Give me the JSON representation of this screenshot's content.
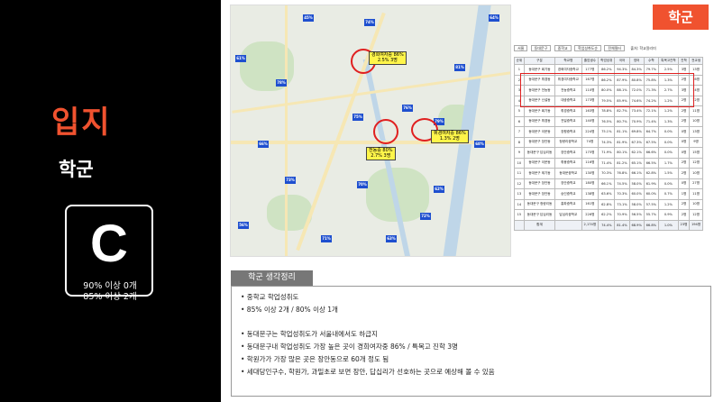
{
  "sidebar": {
    "title": "입지",
    "subtitle": "학군",
    "grade": "C",
    "grade_note_1": "90% 이상 0개",
    "grade_note_2": "85% 이상 2개"
  },
  "tag": "학군",
  "map": {
    "callouts": [
      {
        "l1": "경희여자중 86%",
        "l2": "2.5% 3명"
      },
      {
        "l1": "전농중 80%",
        "l2": "2.7% 3명"
      },
      {
        "l1": "휘경여자중 86%",
        "l2": "1.3% 2명"
      }
    ]
  },
  "filters": {
    "region": "서울",
    "district": "동대문구",
    "level": "중학교",
    "opt1": "학업성취도순",
    "opt2": "전체필터",
    "unit": "출처: 학교알리미"
  },
  "table": {
    "headers": [
      "순위",
      "구분",
      "학교명",
      "졸업생수",
      "학업성취",
      "국어",
      "영어",
      "수학",
      "특목고진학",
      "진학",
      "전교생"
    ],
    "rows": [
      [
        "1",
        "동대문구 회기동",
        "경희여자중학교",
        "177명",
        "86.2%",
        "94.3%",
        "84.3%",
        "79.7%",
        "2.5%",
        "3명",
        "13명"
      ],
      [
        "2",
        "동대문구 휘경동",
        "휘경여자중학교",
        "167명",
        "86.2%",
        "87.9%",
        "80.8%",
        "75.8%",
        "1.3%",
        "2명",
        "16명"
      ],
      [
        "3",
        "동대문구 전농동",
        "전농중학교",
        "110명",
        "80.0%",
        "88.1%",
        "72.0%",
        "71.3%",
        "2.7%",
        "3명",
        "14명"
      ],
      [
        "4",
        "동대문구 신설동",
        "대광중학교",
        "173명",
        "79.5%",
        "85.9%",
        "74.6%",
        "74.2%",
        "1.2%",
        "2명",
        "12명"
      ],
      [
        "5",
        "동대문구 회기동",
        "휘경중학교",
        "163명",
        "78.8%",
        "82.7%",
        "73.4%",
        "72.1%",
        "1.2%",
        "2명",
        "11명"
      ],
      [
        "6",
        "동대문구 휘경동",
        "전일중학교",
        "140명",
        "76.5%",
        "80.7%",
        "70.9%",
        "71.4%",
        "1.3%",
        "2명",
        "10명"
      ],
      [
        "7",
        "동대문구 이문동",
        "장평중학교",
        "224명",
        "75.1%",
        "81.1%",
        "69.8%",
        "64.7%",
        "0.0%",
        "0명",
        "13명"
      ],
      [
        "8",
        "동대문구 장안동",
        "청량리중학교",
        "74명",
        "74.3%",
        "81.9%",
        "67.3%",
        "67.5%",
        "0.0%",
        "0명",
        "9명"
      ],
      [
        "9",
        "동대문구 답십리동",
        "장안중학교",
        "175명",
        "71.9%",
        "80.1%",
        "62.1%",
        "66.6%",
        "0.0%",
        "0명",
        "15명"
      ],
      [
        "10",
        "동대문구 이문동",
        "휘봉중학교",
        "116명",
        "71.4%",
        "81.2%",
        "65.1%",
        "66.5%",
        "1.7%",
        "2명",
        "12명"
      ],
      [
        "11",
        "동대문구 제기동",
        "동대문중학교",
        "130명",
        "70.3%",
        "76.8%",
        "66.1%",
        "62.8%",
        "1.5%",
        "2명",
        "10명"
      ],
      [
        "12",
        "동대문구 장안동",
        "장안중학교",
        "180명",
        "66.1%",
        "74.5%",
        "58.0%",
        "61.9%",
        "0.0%",
        "0명",
        "27명"
      ],
      [
        "13",
        "동대문구 장안동",
        "숭인중학교",
        "138명",
        "63.6%",
        "70.3%",
        "60.0%",
        "60.0%",
        "0.7%",
        "1명",
        "11명"
      ],
      [
        "14",
        "동대문구 청량리동",
        "홍파중학교",
        "161명",
        "62.8%",
        "73.1%",
        "58.0%",
        "57.5%",
        "1.2%",
        "2명",
        "10명"
      ],
      [
        "15",
        "동대문구 답십리동",
        "답십리중학교",
        "226명",
        "62.2%",
        "70.9%",
        "56.5%",
        "55.7%",
        "0.9%",
        "2명",
        "12명"
      ]
    ],
    "total": [
      "",
      "합계",
      "",
      "2,174명",
      "74.4%",
      "81.4%",
      "68.9%",
      "66.8%",
      "1.0%",
      "23명",
      "194명"
    ]
  },
  "summary": {
    "header": "학군 생각정리",
    "lines": [
      "• 중학교 학업성취도",
      "• 85% 이상 2개 / 80% 이상 1개",
      "• 동대문구는 학업성취도가 서울내에서도 하급지",
      "• 동대문구내 학업성취도 가장 높은 곳이 경희여자중 86% / 특목고 진학 3명",
      "• 학원가가 가장 많은 곳은 장안동으로 60개 정도 됨",
      "• 세대당인구수, 학원가, 과밀초로 보면 장안, 답십리가 선호하는 곳으로 예상해 볼 수 있음"
    ]
  }
}
